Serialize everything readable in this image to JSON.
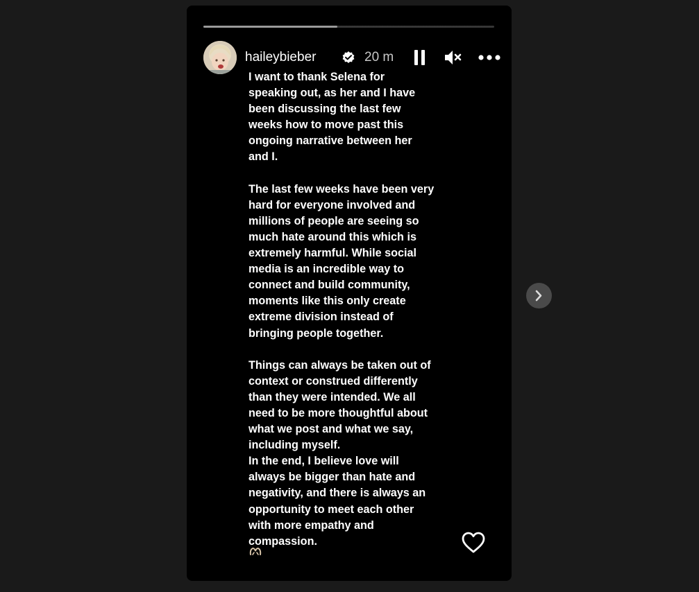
{
  "story": {
    "progress_fraction": 0.46,
    "username": "haileybieber",
    "time_ago": "20 m",
    "verified": true
  },
  "controls": {
    "pause_icon": "pause-icon",
    "mute_icon": "speaker-muted-icon",
    "more_icon": "more-options-icon",
    "like_icon": "heart-outline-icon",
    "next_icon": "chevron-right-icon"
  },
  "text_lines": [
    "I want to thank Selena for",
    "speaking out, as her and I have",
    "been discussing the last few",
    "weeks how to move past this",
    "ongoing narrative between her",
    "and I.",
    "",
    "The last few weeks have been very",
    "hard for everyone involved and",
    "millions of people are seeing so",
    "much hate around this which is",
    "extremely harmful. While social",
    "media is an incredible way to",
    "connect and build community,",
    "moments like this only create",
    "extreme division instead of",
    "bringing people together.",
    "",
    "Things can always be taken out of",
    "context or construed differently",
    "than they were intended. We all",
    "need to be more thoughtful about",
    "what we post and what we say,",
    "including myself.",
    "In the end, I believe love will",
    "always be bigger than hate and",
    "negativity, and there is always an",
    "opportunity to meet each other",
    "with more empathy and",
    "compassion."
  ],
  "emoji": "heart-hands-icon",
  "colors": {
    "background": "#1a1a1a",
    "story_bg": "#000000",
    "text": "#ffffff",
    "timestamp": "#c8c8c8"
  }
}
